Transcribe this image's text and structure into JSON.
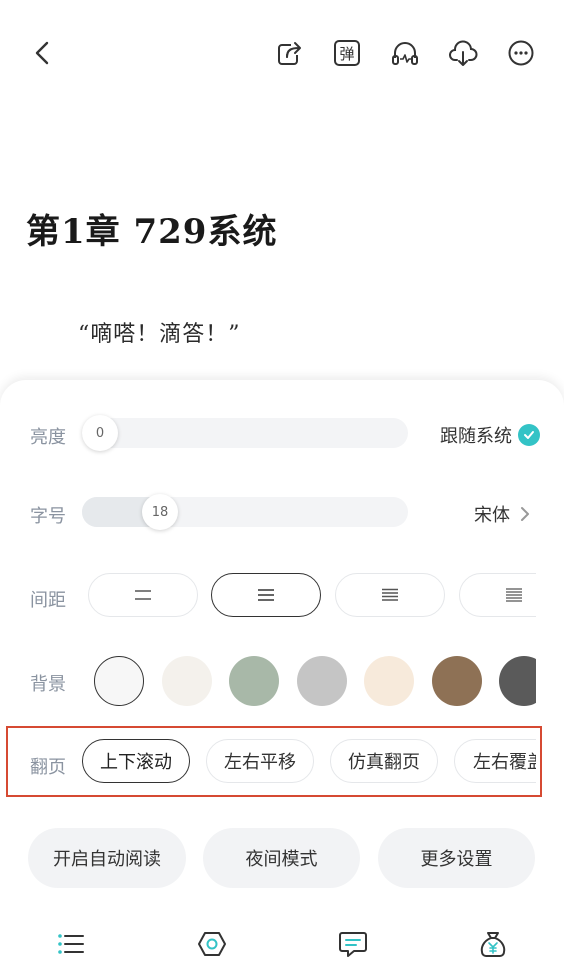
{
  "reader": {
    "chapter_title": "第1章 729系统",
    "paragraph": "“嘀嗒！滴答！”"
  },
  "settings": {
    "brightness": {
      "label": "亮度",
      "value": "0",
      "follow_system": "跟随系统"
    },
    "font_size": {
      "label": "字号",
      "value": "18",
      "font_name": "宋体"
    },
    "spacing": {
      "label": "间距"
    },
    "background": {
      "label": "背景",
      "colors": [
        "#f7f7f7",
        "#f4f1ec",
        "#a8b8a8",
        "#c5c5c5",
        "#f7eadb",
        "#8e7155",
        "#5a5a5a"
      ]
    },
    "page_turn": {
      "label": "翻页",
      "options": [
        "上下滚动",
        "左右平移",
        "仿真翻页",
        "左右覆盖"
      ]
    }
  },
  "actions": {
    "auto_read": "开启自动阅读",
    "night_mode": "夜间模式",
    "more_settings": "更多设置"
  },
  "colors": {
    "accent": "#33c3c6",
    "highlight": "#d64a32"
  }
}
